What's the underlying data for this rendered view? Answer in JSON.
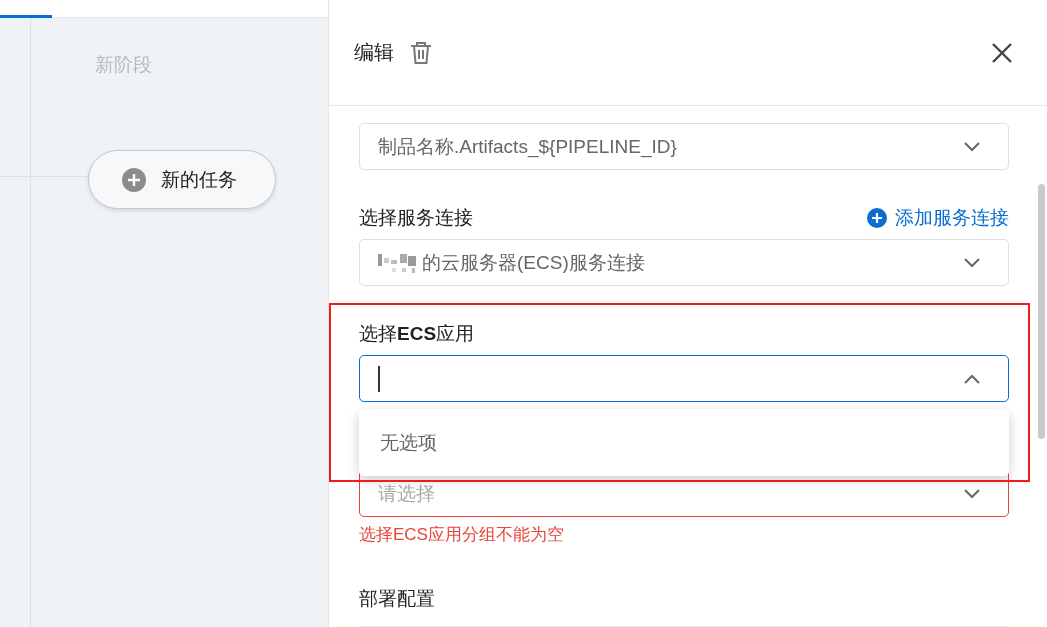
{
  "canvas": {
    "stage_title": "新阶段",
    "task_button": "新的任务"
  },
  "panel": {
    "title": "编辑",
    "fields": [
      {
        "kind": "select",
        "value": "制品名称.Artifacts_${PIPELINE_ID}",
        "focused": false,
        "expanded": false
      },
      {
        "kind": "select",
        "label": "选择服务连接",
        "action": "添加服务连接",
        "value": "的云服务器(ECS)服务连接",
        "redacted": true,
        "focused": false,
        "expanded": false
      },
      {
        "kind": "select",
        "label": "选择**ECS**应用",
        "focused": true,
        "expanded": true,
        "empty_text": "无选项",
        "highlighted": true
      },
      {
        "kind": "select",
        "placeholder": "请选择",
        "error": "选择ECS应用分组不能为空",
        "focused": false,
        "expanded": false
      },
      {
        "kind": "section",
        "label": "部署配置"
      }
    ]
  }
}
